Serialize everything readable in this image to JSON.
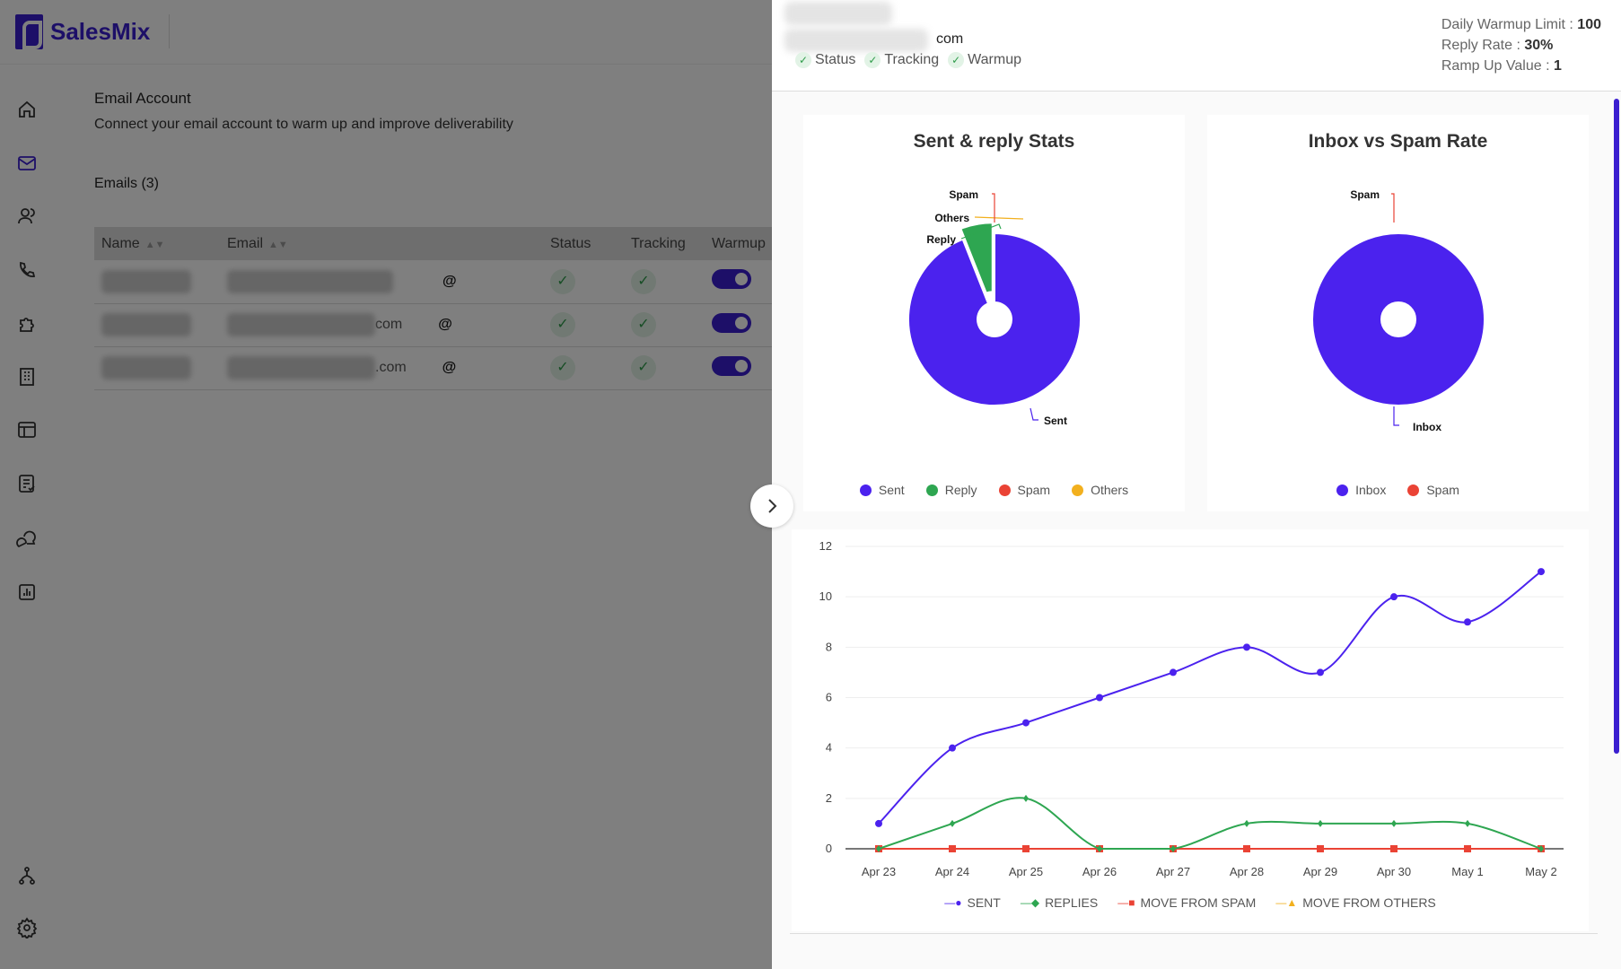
{
  "app": {
    "name": "SalesMix",
    "brand_color": "#3b1fd0"
  },
  "sidebar": {
    "items": [
      "home-icon",
      "mail-icon",
      "users-icon",
      "phone-icon",
      "puzzle-icon",
      "building-icon",
      "layout-icon",
      "checklist-icon",
      "chat-icon",
      "report-icon",
      "hierarchy-icon",
      "gear-icon"
    ],
    "active": "mail-icon"
  },
  "page": {
    "title": "Email Account",
    "subtitle": "Connect your email account to warm up and improve deliverability",
    "count": "Emails (3)"
  },
  "table": {
    "columns": [
      "Name",
      "Email",
      "Status",
      "Tracking",
      "Warmup"
    ],
    "rows": [
      {
        "email_suffix": "@",
        "status": true,
        "tracking": true,
        "warmup": true
      },
      {
        "email_domain": "com",
        "email_suffix": "@",
        "status": true,
        "tracking": true,
        "warmup": true
      },
      {
        "email_domain": ".com",
        "email_suffix": "@",
        "status": true,
        "tracking": true,
        "warmup": true
      }
    ]
  },
  "panel": {
    "email_domain": "com",
    "flags": [
      "Status",
      "Tracking",
      "Warmup"
    ],
    "stats": [
      {
        "label": "Daily Warmup Limit : ",
        "value": "100"
      },
      {
        "label": "Reply Rate : ",
        "value": "30%"
      },
      {
        "label": "Ramp Up Value : ",
        "value": "1"
      }
    ]
  },
  "chart_data": [
    {
      "type": "pie",
      "title": "Sent & reply Stats",
      "donut": true,
      "slices": [
        {
          "name": "Sent",
          "value": 94,
          "color": "#4b22ee"
        },
        {
          "name": "Reply",
          "value": 6,
          "color": "#2ea651"
        },
        {
          "name": "Spam",
          "value": 0,
          "color": "#ea4335"
        },
        {
          "name": "Others",
          "value": 0,
          "color": "#f2b01e"
        }
      ],
      "legend": "bottom"
    },
    {
      "type": "pie",
      "title": "Inbox vs Spam Rate",
      "donut": true,
      "slices": [
        {
          "name": "Inbox",
          "value": 100,
          "color": "#4b22ee"
        },
        {
          "name": "Spam",
          "value": 0,
          "color": "#ea4335"
        }
      ],
      "legend": "bottom"
    },
    {
      "type": "line",
      "smooth": true,
      "categories": [
        "Apr 23",
        "Apr 24",
        "Apr 25",
        "Apr 26",
        "Apr 27",
        "Apr 28",
        "Apr 29",
        "Apr 30",
        "May 1",
        "May 2"
      ],
      "ylim": [
        0,
        12
      ],
      "yticks": [
        0,
        2,
        4,
        6,
        8,
        10,
        12
      ],
      "grid": true,
      "legend": "bottom",
      "series": [
        {
          "name": "SENT",
          "color": "#4b22ee",
          "marker": "circle",
          "values": [
            1,
            4,
            5,
            6,
            7,
            8,
            7,
            10,
            9,
            11
          ]
        },
        {
          "name": "REPLIES",
          "color": "#2ea651",
          "marker": "diamond",
          "values": [
            0,
            1,
            2,
            0,
            0,
            1,
            1,
            1,
            1,
            0
          ]
        },
        {
          "name": "MOVE FROM SPAM",
          "color": "#ea4335",
          "marker": "square",
          "values": [
            0,
            0,
            0,
            0,
            0,
            0,
            0,
            0,
            0,
            0
          ]
        },
        {
          "name": "MOVE FROM OTHERS",
          "color": "#f2b01e",
          "marker": "triangle",
          "values": [
            0,
            0,
            0,
            0,
            0,
            0,
            0,
            0,
            0,
            0
          ]
        }
      ]
    }
  ]
}
